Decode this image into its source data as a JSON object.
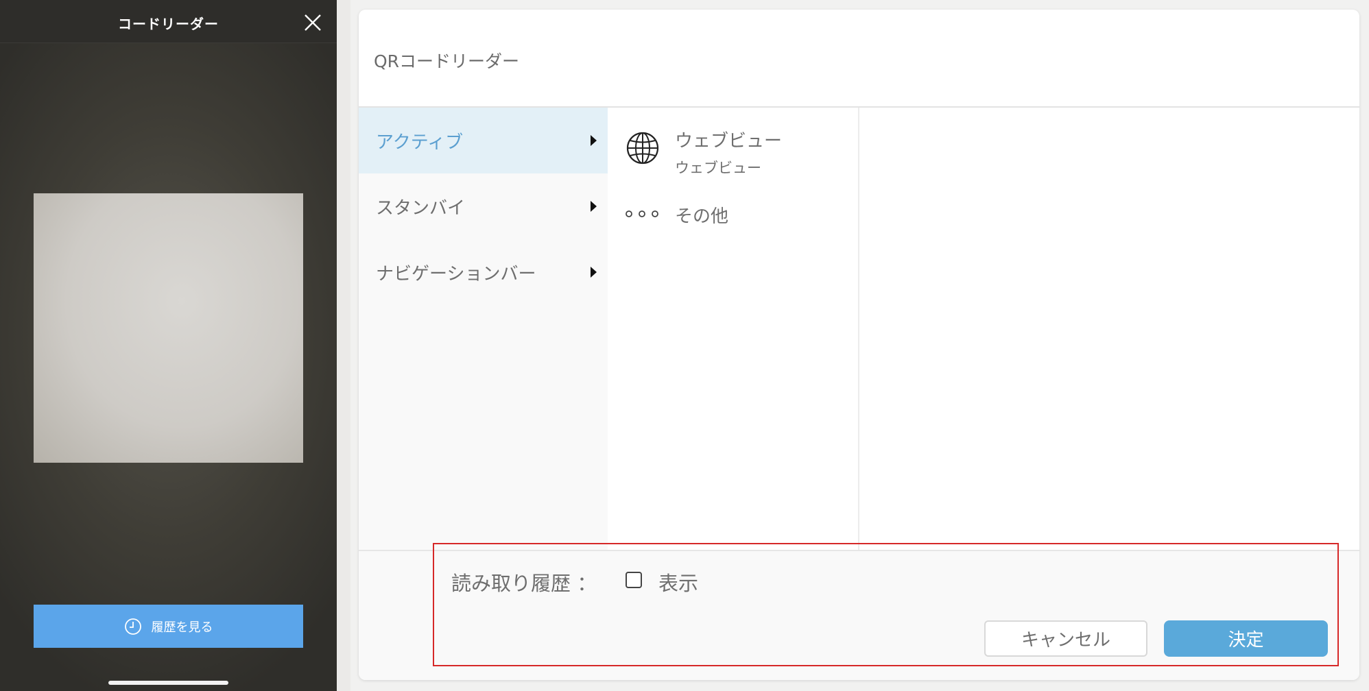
{
  "phone": {
    "header_title": "コードリーダー",
    "close_icon": "close-icon",
    "history_button_label": "履歴を見る",
    "history_icon": "clock-icon"
  },
  "dialog": {
    "title": "QRコードリーダー",
    "menu": {
      "items": [
        {
          "label": "アクティブ",
          "active": true
        },
        {
          "label": "スタンバイ",
          "active": false
        },
        {
          "label": "ナビゲーションバー",
          "active": false
        }
      ]
    },
    "submenu": {
      "webview_label": "ウェブビュー",
      "webview_sublabel": "ウェブビュー",
      "webview_icon": "globe-icon",
      "other_label": "その他",
      "other_icon": "dots-icon"
    },
    "footer": {
      "history_label": "読み取り履歴 ：",
      "show_label": "表示",
      "show_checked": false,
      "cancel_label": "キャンセル",
      "ok_label": "決定"
    }
  },
  "colors": {
    "accent_blue": "#5ba5ea",
    "ok_blue": "#5aa9da",
    "active_menu_bg": "#e3f0f7",
    "active_menu_text": "#5b9fd0",
    "highlight_red": "#d62828"
  }
}
